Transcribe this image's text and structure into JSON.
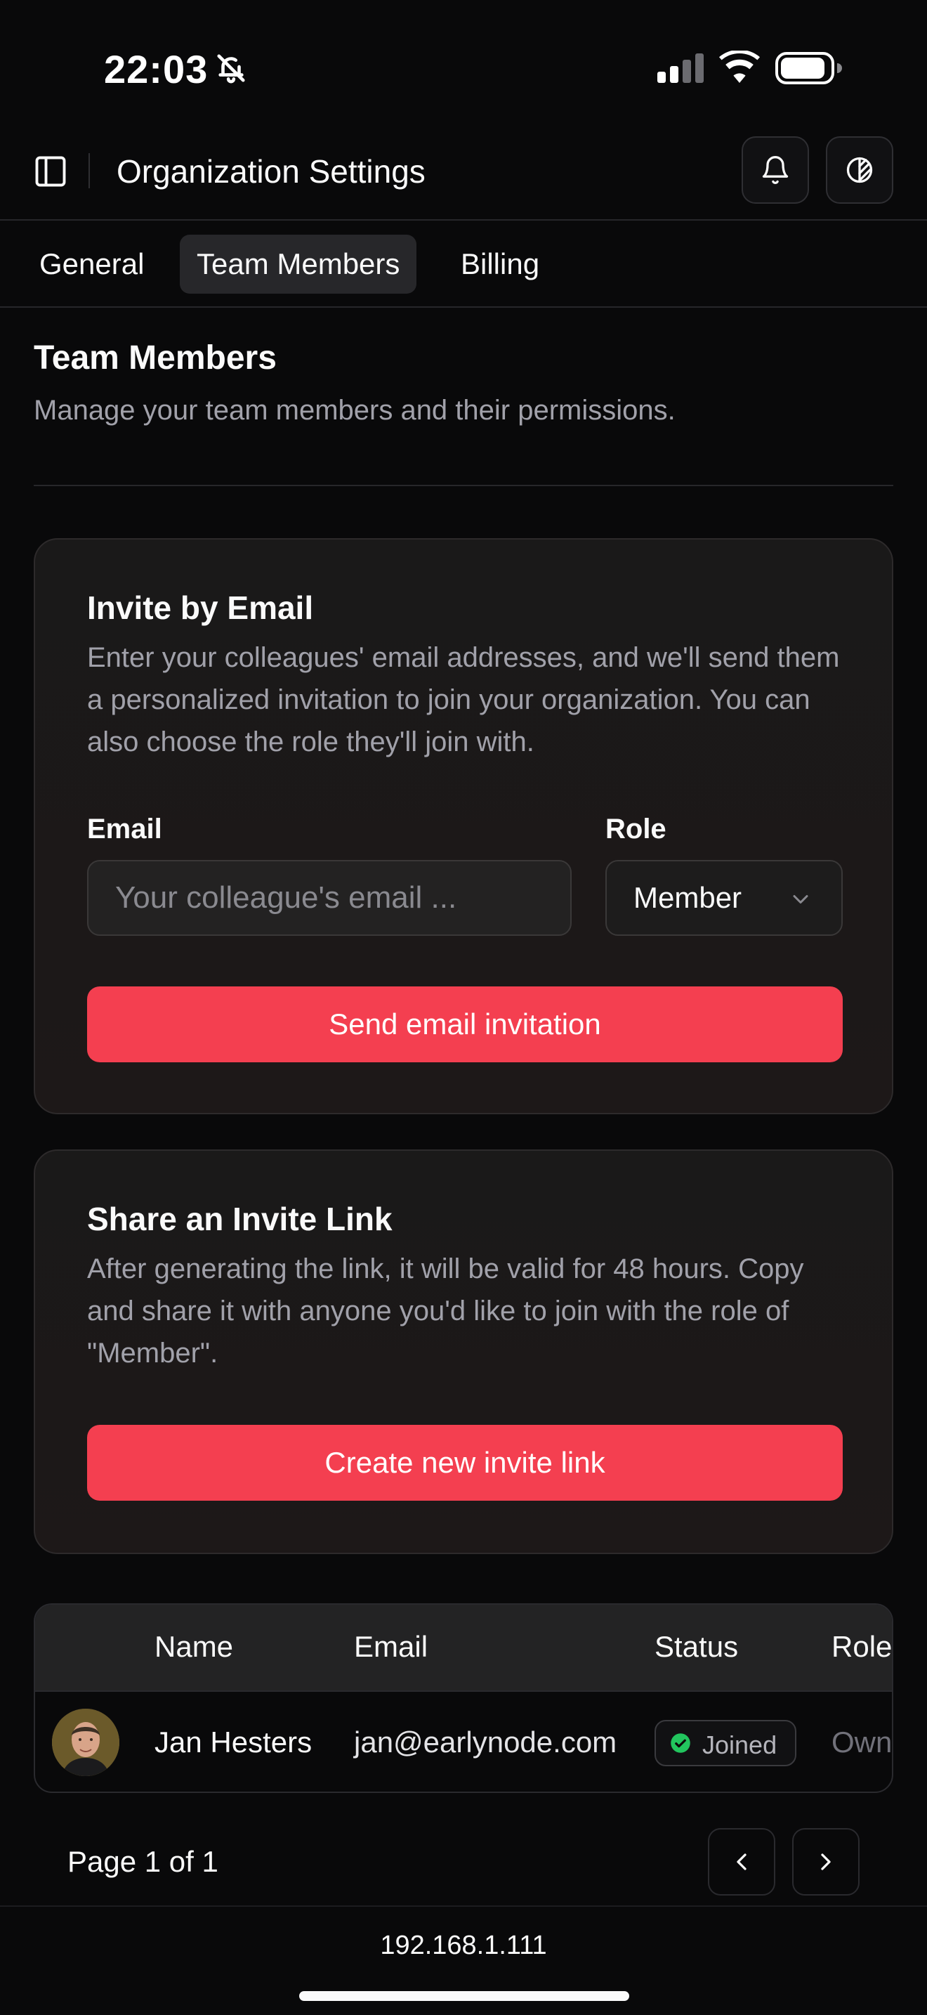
{
  "status_bar": {
    "time": "22:03",
    "icons": [
      "bell-slash-icon",
      "cellular-signal-icon",
      "wifi-icon",
      "battery-icon"
    ]
  },
  "header": {
    "title": "Organization Settings",
    "icons": [
      "sidebar-toggle-icon",
      "bell-icon",
      "theme-toggle-icon"
    ]
  },
  "tabs": [
    {
      "label": "General",
      "active": false
    },
    {
      "label": "Team Members",
      "active": true
    },
    {
      "label": "Billing",
      "active": false
    }
  ],
  "section": {
    "title": "Team Members",
    "description": "Manage your team members and their permissions."
  },
  "invite_email": {
    "title": "Invite by Email",
    "description": "Enter your colleagues' email addresses, and we'll send them a personalized invitation to join your organization. You can also choose the role they'll join with.",
    "email_label": "Email",
    "email_placeholder": "Your colleague's email ...",
    "role_label": "Role",
    "role_value": "Member",
    "button": "Send email invitation"
  },
  "invite_link": {
    "title": "Share an Invite Link",
    "description": "After generating the link, it will be valid for 48 hours. Copy and share it with anyone you'd like to join with the role of \"Member\".",
    "button": "Create new invite link"
  },
  "members_table": {
    "columns": [
      "Name",
      "Email",
      "Status",
      "Role"
    ],
    "rows": [
      {
        "name": "Jan Hesters",
        "email": "jan@earlynode.com",
        "status": "Joined",
        "role": "Own"
      }
    ]
  },
  "pagination": {
    "label": "Page 1 of 1"
  },
  "browser": {
    "url": "192.168.1.111"
  },
  "colors": {
    "accent": "#f43f50",
    "success": "#22c55e",
    "background": "#09090a"
  }
}
